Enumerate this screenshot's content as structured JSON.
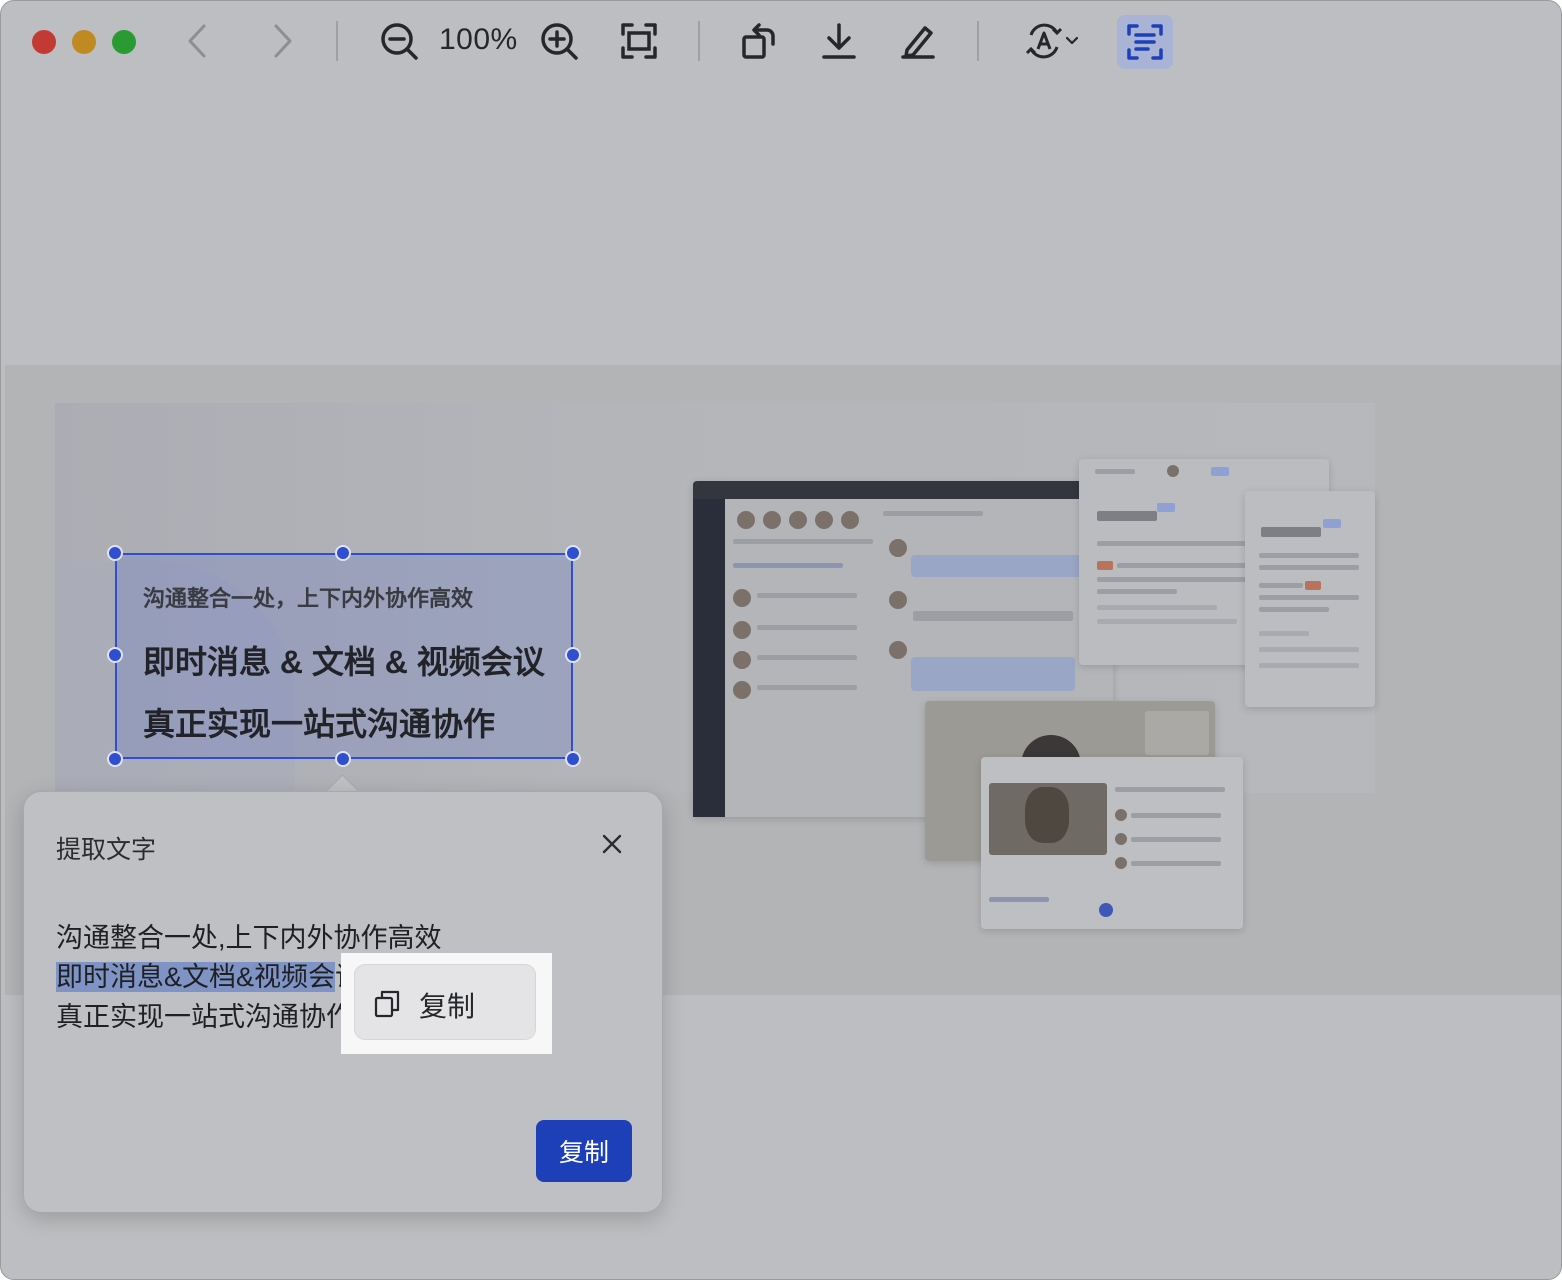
{
  "toolbar": {
    "zoom_level": "100%",
    "icons": [
      "chevron-left-icon",
      "chevron-right-icon",
      "zoom-out-icon",
      "zoom-in-icon",
      "fit-screen-icon",
      "rotate-icon",
      "download-icon",
      "edit-pen-icon",
      "translate-icon",
      "extract-text-icon"
    ]
  },
  "image_text": {
    "line1": "沟通整合一处，上下内外协作高效",
    "line2": "即时消息 & 文档 & 视频会议",
    "line3": "真正实现一站式沟通协作"
  },
  "extract_panel": {
    "title": "提取文字",
    "line1": "沟通整合一处,上下内外协作高效",
    "line2_selected": "即时消息&文档&视频会",
    "line2_rest": "议",
    "line3": "真正实现一站式沟通协作",
    "copy_button": "复制"
  },
  "context_menu": {
    "copy_label": "复制"
  },
  "colors": {
    "accent": "#1d3fb8",
    "selection": "#2f4fd0"
  }
}
